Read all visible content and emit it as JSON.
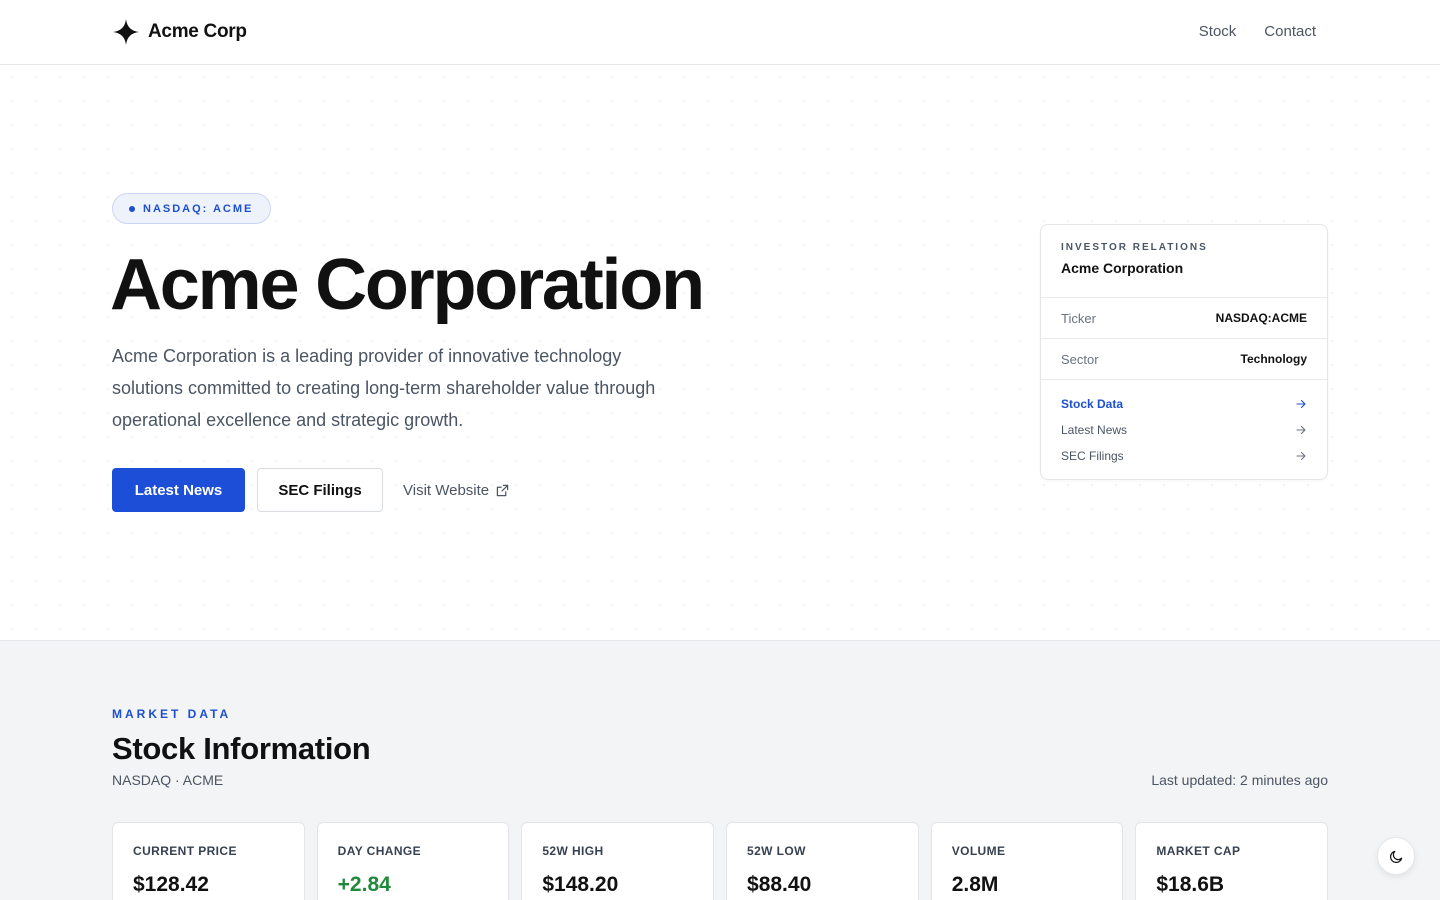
{
  "header": {
    "brand_name": "Acme Corp",
    "nav": [
      "Stock",
      "Contact"
    ]
  },
  "hero": {
    "badge": "NASDAQ: ACME",
    "title": "Acme Corporation",
    "description": "Acme Corporation is a leading provider of innovative technology solutions committed to creating long-term shareholder value through operational excellence and strategic growth.",
    "primary_button": "Latest News",
    "secondary_button": "SEC Filings",
    "link_label": "Visit Website"
  },
  "ir_card": {
    "eyebrow": "INVESTOR RELATIONS",
    "company": "Acme Corporation",
    "rows": [
      {
        "label": "Ticker",
        "value": "NASDAQ:ACME"
      },
      {
        "label": "Sector",
        "value": "Technology"
      }
    ],
    "links": [
      "Stock Data",
      "Latest News",
      "SEC Filings"
    ],
    "active_link": "Stock Data"
  },
  "market": {
    "eyebrow": "MARKET DATA",
    "title": "Stock Information",
    "subtitle": "NASDAQ · ACME",
    "last_updated": "Last updated: 2 minutes ago",
    "stats": [
      {
        "label": "CURRENT PRICE",
        "value": "$128.42"
      },
      {
        "label": "DAY CHANGE",
        "value": "+2.84"
      },
      {
        "label": "52W HIGH",
        "value": "$148.20"
      },
      {
        "label": "52W LOW",
        "value": "$88.40"
      },
      {
        "label": "VOLUME",
        "value": "2.8M"
      },
      {
        "label": "MARKET CAP",
        "value": "$18.6B"
      }
    ]
  },
  "colors": {
    "accent": "#1d4ed8",
    "positive": "#1f8a3b",
    "section_bg": "#f3f4f6"
  },
  "icons": {
    "brand": "four-point-star-icon",
    "external_link": "external-link-icon",
    "arrow": "arrow-right-icon",
    "theme": "moon-icon"
  }
}
